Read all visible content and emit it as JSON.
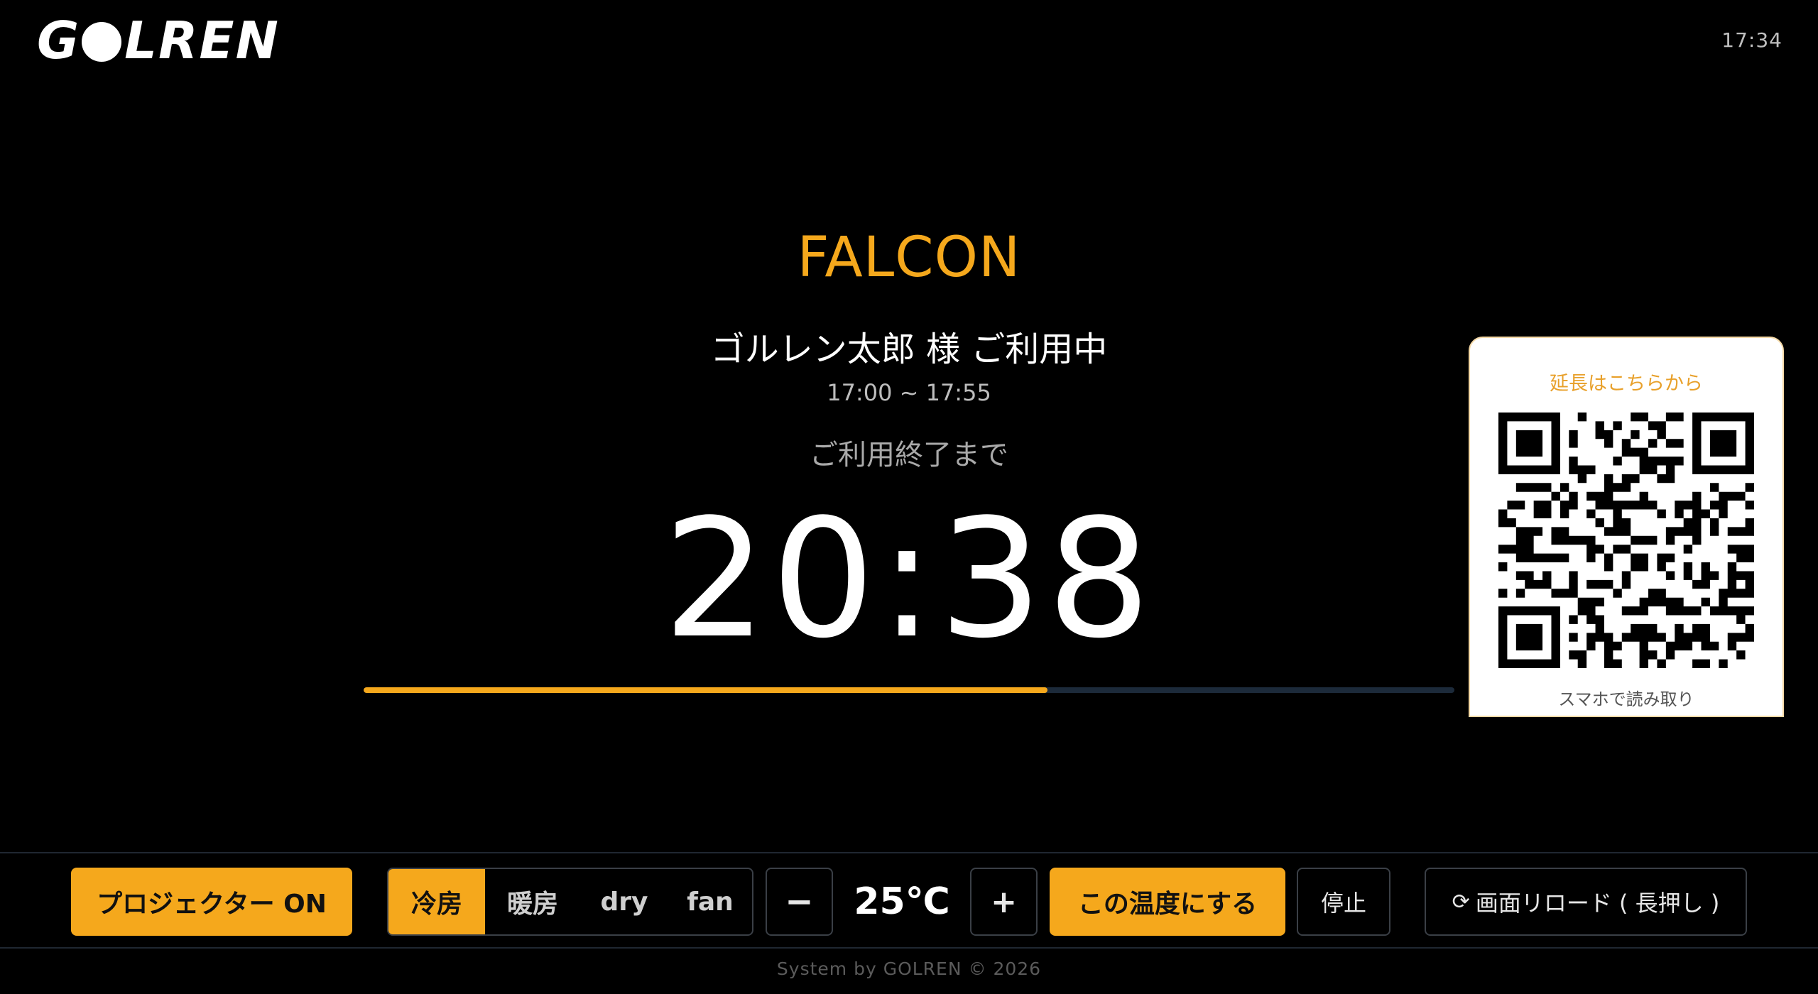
{
  "header": {
    "logo_left": "G",
    "logo_right": "LREN",
    "clock": "17:34"
  },
  "main": {
    "room_name": "FALCON",
    "user_line": "ゴルレン太郎 様 ご利用中",
    "time_range": "17:00 ~ 17:55",
    "remaining_label": "ご利用終了まで",
    "countdown": "20:38",
    "progress_fraction": 0.627
  },
  "qr": {
    "title": "延長はこちらから",
    "caption": "スマホで読み取り"
  },
  "controls": {
    "projector_label": "プロジェクター ON",
    "modes": [
      {
        "label": "冷房",
        "active": true
      },
      {
        "label": "暖房",
        "active": false
      },
      {
        "label": "dry",
        "active": false
      },
      {
        "label": "fan",
        "active": false
      }
    ],
    "minus_label": "−",
    "temperature": "25℃",
    "plus_label": "+",
    "apply_label": "この温度にする",
    "stop_label": "停止",
    "reload_icon": "⟳",
    "reload_label": "画面リロード ( 長押し )"
  },
  "footer": {
    "text": "System by GOLREN © 2026"
  },
  "colors": {
    "accent": "#f5a81c",
    "background": "#000000",
    "progress_track": "#1c2a3a"
  }
}
